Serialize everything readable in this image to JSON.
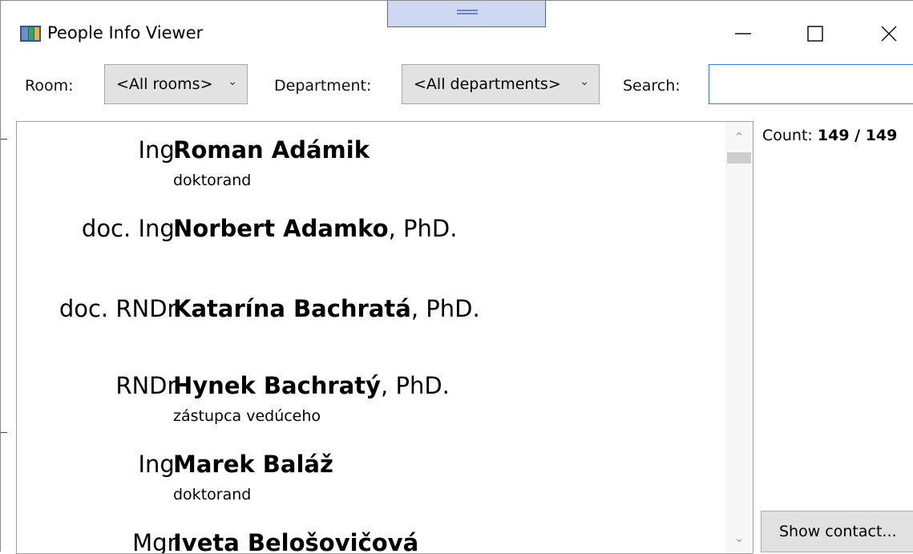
{
  "window": {
    "title": "People Info Viewer",
    "icon": "app-window-icon"
  },
  "filters": {
    "room_label": "Room:",
    "room_value": "<All rooms>",
    "department_label": "Department:",
    "department_value": "<All departments>",
    "search_label": "Search:",
    "search_value": ""
  },
  "people": [
    {
      "prefix": "Ing.",
      "name": "Roman Adámik",
      "suffix": "",
      "role": "doktorand"
    },
    {
      "prefix": "doc. Ing.",
      "name": "Norbert Adamko",
      "suffix": ", PhD.",
      "role": ""
    },
    {
      "prefix": "doc. RNDr.",
      "name": "Katarína Bachratá",
      "suffix": ", PhD.",
      "role": ""
    },
    {
      "prefix": "RNDr.",
      "name": "Hynek Bachratý",
      "suffix": ", PhD.",
      "role": "zástupca vedúceho"
    },
    {
      "prefix": "Ing.",
      "name": "Marek Baláž",
      "suffix": "",
      "role": "doktorand"
    },
    {
      "prefix": "Mgr.",
      "name": "Iveta Belošovičová",
      "suffix": "",
      "role": ""
    }
  ],
  "count": {
    "label": "Count:",
    "value": "149 / 149"
  },
  "show_contact_label": "Show contact..."
}
